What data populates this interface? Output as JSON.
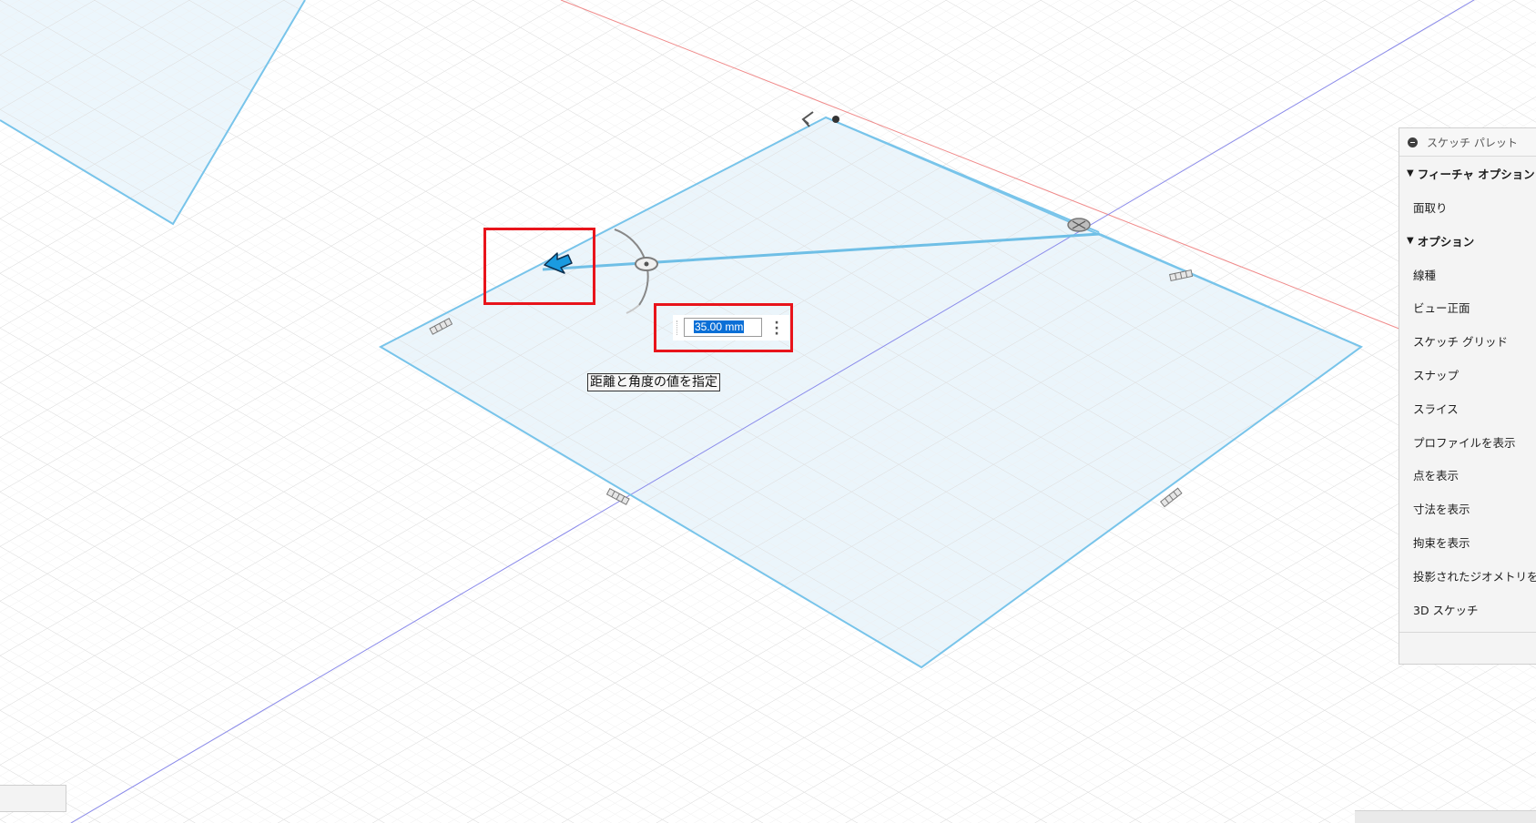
{
  "dimension": {
    "value": "35.00 mm",
    "menu_icon": "more-vertical-icon"
  },
  "tooltip": {
    "text": "距離と角度の値を指定"
  },
  "palette": {
    "title": "スケッチ パレット",
    "sections": [
      {
        "label": "フィーチャ オプション",
        "items": [
          "面取り"
        ]
      },
      {
        "label": "オプション",
        "items": [
          "線種",
          "ビュー正面",
          "スケッチ グリッド",
          "スナップ",
          "スライス",
          "プロファイルを表示",
          "点を表示",
          "寸法を表示",
          "拘束を表示",
          "投影されたジオメトリを表示",
          "3D スケッチ"
        ]
      }
    ]
  },
  "colors": {
    "plane_fill": "#e9f4fb",
    "plane_edge": "#78c4ea",
    "sketch_line": "#6fbfe6",
    "axis_red": "#f08080",
    "axis_blue": "#7b7be0",
    "grid_minor": "#ededed",
    "grid_major": "#d6d6d6",
    "highlight": "#e8141b",
    "cursor": "#1a9be0"
  }
}
